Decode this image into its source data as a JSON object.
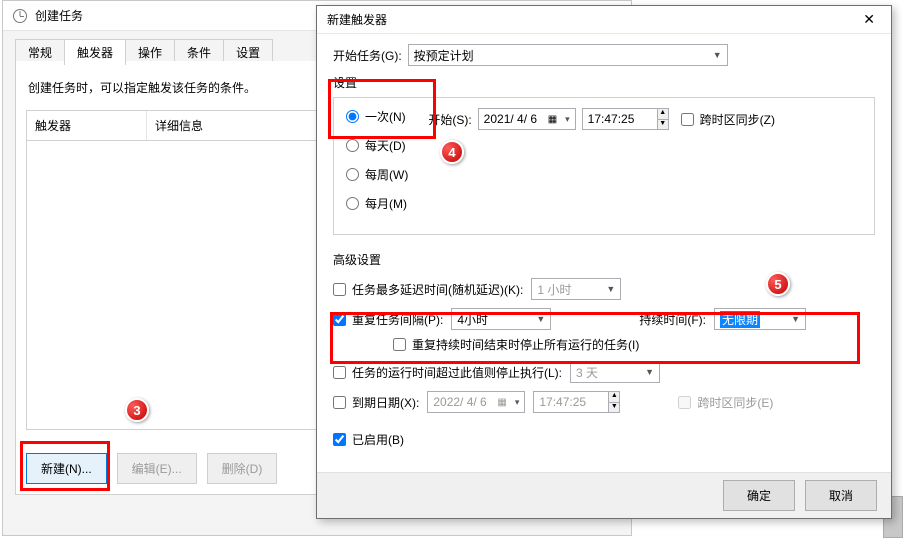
{
  "back": {
    "title": "创建任务",
    "tabs": [
      "常规",
      "触发器",
      "操作",
      "条件",
      "设置"
    ],
    "active_tab_index": 1,
    "desc": "创建任务时，可以指定触发该任务的条件。",
    "col1": "触发器",
    "col2": "详细信息",
    "btn_new": "新建(N)...",
    "btn_edit": "编辑(E)...",
    "btn_del": "删除(D)"
  },
  "dlg": {
    "title": "新建触发器",
    "close": "✕",
    "start_task_lbl": "开始任务(G):",
    "start_task_val": "按预定计划",
    "settings_lbl": "设置",
    "radios": {
      "once": "一次(N)",
      "daily": "每天(D)",
      "weekly": "每周(W)",
      "monthly": "每月(M)"
    },
    "start_lbl": "开始(S):",
    "start_date": "2021/ 4/ 6",
    "start_time": "17:47:25",
    "sync_tz": "跨时区同步(Z)",
    "adv_lbl": "高级设置",
    "delay_lbl": "任务最多延迟时间(随机延迟)(K):",
    "delay_val": "1 小时",
    "repeat_lbl": "重复任务间隔(P):",
    "repeat_val": "4小时",
    "duration_lbl": "持续时间(F):",
    "duration_val": "无限期",
    "stop_at_end_lbl": "重复持续时间结束时停止所有运行的任务(I)",
    "stop_if_lbl": "任务的运行时间超过此值则停止执行(L):",
    "stop_if_val": "3 天",
    "expire_lbl": "到期日期(X):",
    "expire_date": "2022/ 4/ 6",
    "expire_time": "17:47:25",
    "sync_tz2": "跨时区同步(E)",
    "enabled_lbl": "已启用(B)",
    "ok": "确定",
    "cancel": "取消"
  },
  "markers": {
    "m3": "3",
    "m4": "4",
    "m5": "5"
  }
}
